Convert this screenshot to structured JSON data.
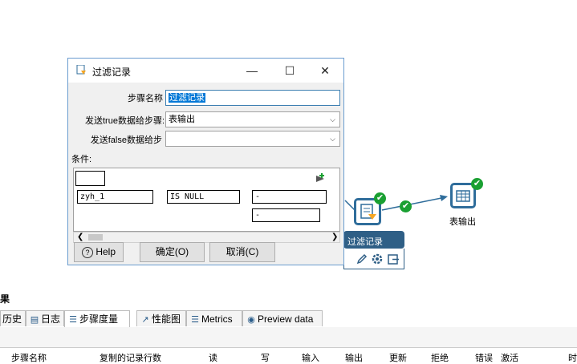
{
  "canvas": {
    "filter_step_label": "过滤记录",
    "output_step_label": "表输出",
    "check_mark": "✔"
  },
  "dialog": {
    "title": "过滤记录",
    "win_minimize": "—",
    "win_maximize": "☐",
    "win_close": "✕",
    "step_name_label": "步骤名称",
    "step_name_value": "过滤记录",
    "true_label": "发送true数据给步骤:",
    "true_value": "表输出",
    "false_label": "发送false数据给步",
    "false_value": "",
    "condition_label": "条件:",
    "condition": {
      "field": "zyh_1",
      "function": "IS NULL",
      "value": "-",
      "value2": "-"
    },
    "help_button": "Help",
    "ok_button": "确定(O)",
    "cancel_button": "取消(C)"
  },
  "panel": {
    "title": "果",
    "tabs": [
      {
        "label": "历史"
      },
      {
        "label": "日志"
      },
      {
        "label": "步骤度量"
      },
      {
        "label": "性能图"
      },
      {
        "label": "Metrics"
      },
      {
        "label": "Preview data"
      }
    ],
    "columns": [
      "步骤名称",
      "复制的记录行数",
      "读",
      "写",
      "输入",
      "输出",
      "更新",
      "拒绝",
      "错误",
      "激活",
      "时"
    ]
  }
}
